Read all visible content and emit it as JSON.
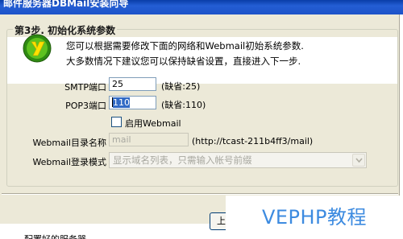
{
  "window": {
    "title": "邮件服务器DBMail安装向导"
  },
  "step": {
    "title": "第3步. 初始化系统参数"
  },
  "header": {
    "desc_line1": "您可以根据需要修改下面的网络和Webmail初始系统参数.",
    "desc_line2": "大多数情况下建议您可以保持缺省设置，直接进入下一步."
  },
  "form": {
    "smtp_label": "SMTP端口",
    "smtp_value": "25",
    "smtp_hint": "(缺省:25)",
    "pop3_label": "POP3端口",
    "pop3_value": "110",
    "pop3_hint": "(缺省:110)",
    "webmail_checkbox_label": "启用Webmail",
    "webmail_checked": false,
    "webmail_dir_label": "Webmail目录名称",
    "webmail_dir_value": "mail",
    "webmail_dir_hint": "(http://tcast-211b4ff3/mail)",
    "webmail_mode_label": "Webmail登录模式",
    "webmail_mode_value": "显示域名列表，只需输入帐号前缀"
  },
  "buttons": {
    "prev_label": "上"
  },
  "watermark": {
    "text": "VEPHP教程"
  },
  "footer": {
    "text": "配置好的服务器"
  },
  "icons": {
    "logo": "green-shield-logo",
    "dropdown": "chevron-down-icon"
  }
}
